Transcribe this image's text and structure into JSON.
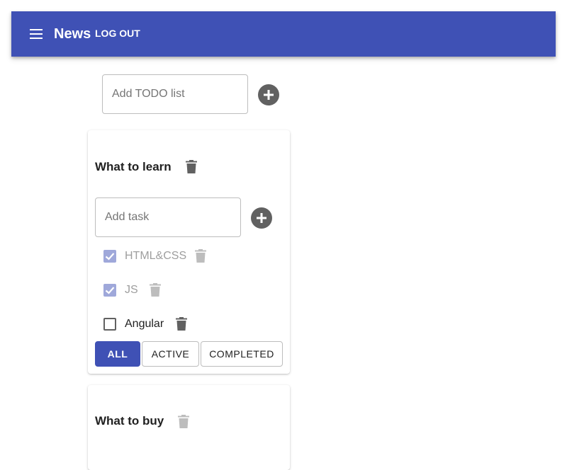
{
  "appbar": {
    "title": "News",
    "logout_label": "LOG OUT"
  },
  "new_list": {
    "placeholder": "Add TODO list"
  },
  "lists": [
    {
      "title": "What to learn",
      "task_placeholder": "Add task",
      "tasks": [
        {
          "label": "HTML&CSS",
          "done": true
        },
        {
          "label": "JS",
          "done": true
        },
        {
          "label": "Angular",
          "done": false
        }
      ],
      "filters": {
        "all": "ALL",
        "active": "ACTIVE",
        "completed": "COMPLETED",
        "selected": "ALL"
      }
    },
    {
      "title": "What to buy"
    }
  ],
  "colors": {
    "primary": "#3f51b5",
    "checked": "#9fa8da",
    "icon": "#616161",
    "icon_muted": "#bdbdbd"
  }
}
